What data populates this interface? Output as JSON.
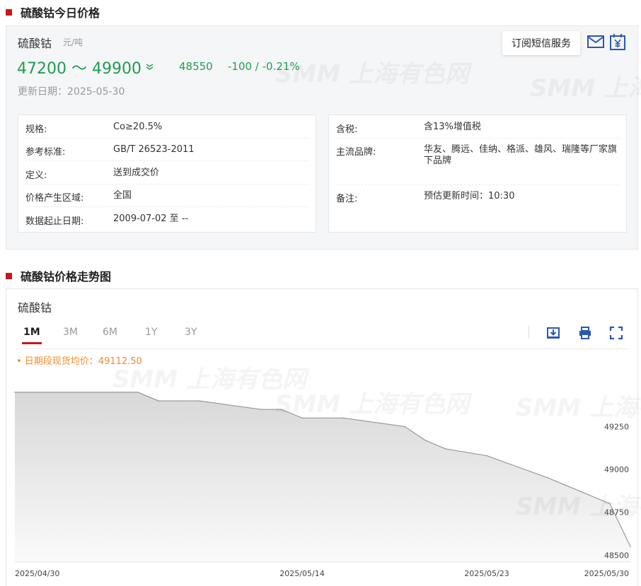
{
  "section1": {
    "title": "硫酸钴今日价格"
  },
  "product": {
    "name": "硫酸钴",
    "unit": "元/吨",
    "price_range": "47200 ～ 49900",
    "avg_price": "48550",
    "change": "-100  /  -0.21%",
    "update_date": "更新日期：2025-05-30",
    "trend_icon": "double-chevron-down-icon"
  },
  "subscribe": {
    "label": "订阅短信服务"
  },
  "info_left": [
    {
      "key": "规格:",
      "value": "Co≥20.5%"
    },
    {
      "key": "参考标准:",
      "value": "GB/T 26523-2011"
    },
    {
      "key": "定义:",
      "value": "送到成交价"
    },
    {
      "key": "价格产生区域:",
      "value": "全国"
    },
    {
      "key": "数据起止日期:",
      "value": "2009-07-02 至 --"
    }
  ],
  "info_right": [
    {
      "key": "含税:",
      "value": "含13%增值税"
    },
    {
      "key": "主流品牌:",
      "value": "华友、腾远、佳纳、格派、雄风、瑞隆等厂家旗下品牌"
    },
    {
      "key": "备注:",
      "value": "预估更新时间：10:30"
    }
  ],
  "section2": {
    "title": "硫酸钴价格走势图"
  },
  "chart_panel": {
    "name": "硫酸钴",
    "tabs": [
      "1M",
      "3M",
      "6M",
      "1Y",
      "3Y"
    ],
    "active_tab": "1M",
    "avg_label": "• 日期段现货均价：49112.50",
    "tools": [
      "download-icon",
      "print-icon",
      "fullscreen-icon"
    ]
  },
  "watermark": "SMM 上海有色网",
  "colors": {
    "accent": "#c8161d",
    "down": "#1e9e4f",
    "avg": "#f08c2e",
    "line": "#999999"
  },
  "chart_data": {
    "type": "area",
    "title": "",
    "xlabel": "",
    "ylabel": "",
    "x_tick_labels": [
      "2025/04/30",
      "2025/05/14",
      "2025/05/23",
      "2025/05/30"
    ],
    "y_tick_labels": [
      "49250",
      "49000",
      "48750",
      "48500"
    ],
    "ylim": [
      48460,
      49590
    ],
    "grid": false,
    "legend": "none",
    "x": [
      "2025-04-30",
      "2025-05-06",
      "2025-05-07",
      "2025-05-08",
      "2025-05-09",
      "2025-05-12",
      "2025-05-13",
      "2025-05-14",
      "2025-05-15",
      "2025-05-16",
      "2025-05-19",
      "2025-05-20",
      "2025-05-21",
      "2025-05-22",
      "2025-05-23",
      "2025-05-26",
      "2025-05-27",
      "2025-05-28",
      "2025-05-29",
      "2025-05-30"
    ],
    "series": [
      {
        "values": [
          49450,
          49450,
          49400,
          49400,
          49400,
          49350,
          49350,
          49300,
          49300,
          49300,
          49250,
          49170,
          49120,
          49100,
          49080,
          48950,
          48900,
          48850,
          48800,
          48550
        ]
      }
    ]
  }
}
